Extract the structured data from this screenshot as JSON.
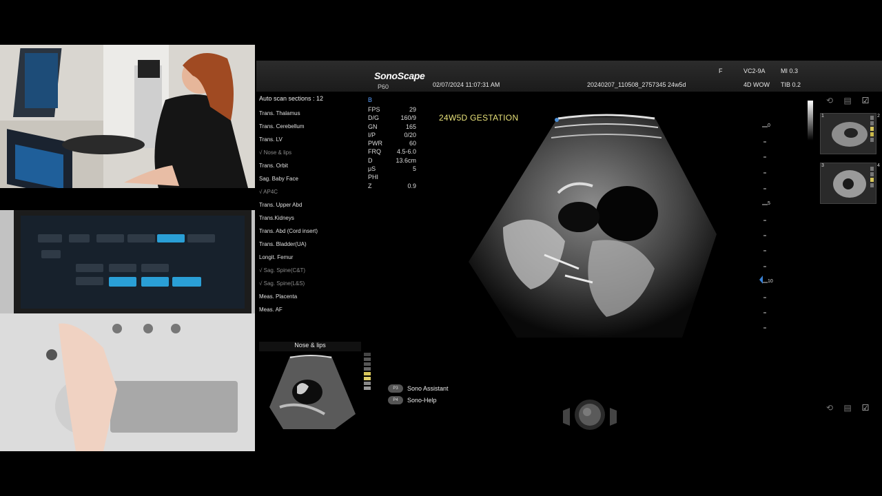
{
  "header": {
    "logo": "SonoScape",
    "model": "P60",
    "datetime": "02/07/2024 11:07:31 AM",
    "exam_id": "20240207_110508_2757345  24w5d",
    "freq_flag": "F",
    "probe": "VC2-9A",
    "mode_name": "4D WOW",
    "mi": "MI 0.3",
    "tib": "TIB 0.2"
  },
  "auto_scan": {
    "title": "Auto scan sections : 12",
    "items": [
      {
        "label": "Trans. Thalamus",
        "done": false
      },
      {
        "label": "Trans. Cerebellum",
        "done": false
      },
      {
        "label": "Trans. LV",
        "done": false
      },
      {
        "label": "√ Nose & lips",
        "done": true
      },
      {
        "label": "Trans. Orbit",
        "done": false
      },
      {
        "label": "Sag. Baby Face",
        "done": false
      },
      {
        "label": "√ AP4C",
        "done": true
      },
      {
        "label": "Trans. Upper Abd",
        "done": false
      },
      {
        "label": "Trans.Kidneys",
        "done": false
      },
      {
        "label": "Trans. Abd (Cord insert)",
        "done": false
      },
      {
        "label": "Trans. Bladder(UA)",
        "done": false
      },
      {
        "label": "Longit. Femur",
        "done": false
      },
      {
        "label": "√ Sag. Spine(C&T)",
        "done": true
      },
      {
        "label": "√ Sag. Spine(L&S)",
        "done": true
      },
      {
        "label": "Meas. Placenta",
        "done": false
      },
      {
        "label": "Meas. AF",
        "done": false
      }
    ]
  },
  "params": {
    "mode": "B",
    "rows": [
      {
        "k": "FPS",
        "v": "29"
      },
      {
        "k": "D/G",
        "v": "160/9"
      },
      {
        "k": "GN",
        "v": "165"
      },
      {
        "k": "I/P",
        "v": "0/20"
      },
      {
        "k": "PWR",
        "v": "60"
      },
      {
        "k": "FRQ",
        "v": "4.5-6.0"
      },
      {
        "k": "D",
        "v": "13.6cm"
      },
      {
        "k": "μS",
        "v": "5"
      },
      {
        "k": "PHI",
        "v": ""
      },
      {
        "k": "Z",
        "v": "0.9"
      }
    ]
  },
  "image_annotation": "24W5D GESTATION",
  "depth_labels": [
    "0",
    "5",
    "10"
  ],
  "thumbnail": {
    "title": "Nose & lips"
  },
  "hotkeys": [
    {
      "key": "P3",
      "label": "Sono Assistant"
    },
    {
      "key": "P4",
      "label": "Sono-Help"
    }
  ],
  "right_thumbs": [
    "1",
    "2",
    "3",
    "4"
  ],
  "tools": [
    "rotate-icon",
    "layout-icon",
    "check-icon"
  ],
  "colors": {
    "accent_yellow": "#e8e27a",
    "topbar": "#222222",
    "touch_blue": "#2a9fd6"
  }
}
